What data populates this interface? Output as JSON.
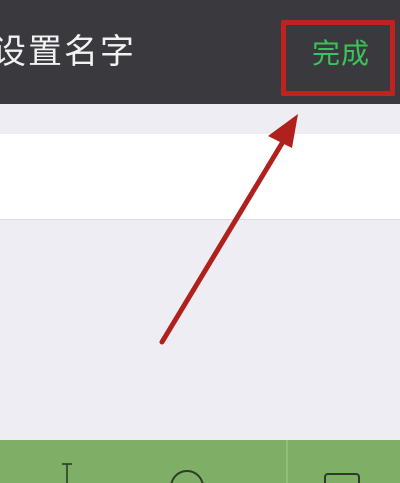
{
  "header": {
    "title": "设置名字",
    "done_label": "完成"
  },
  "name_input": {
    "value": "",
    "placeholder": ""
  },
  "bottom_bar": {
    "icons": [
      "text-format-icon",
      "emoji-icon",
      "keyboard-icon"
    ]
  },
  "annotation": {
    "highlight_color": "#c0221f",
    "arrow_color": "#b0201d",
    "done_color": "#3cc25a"
  }
}
